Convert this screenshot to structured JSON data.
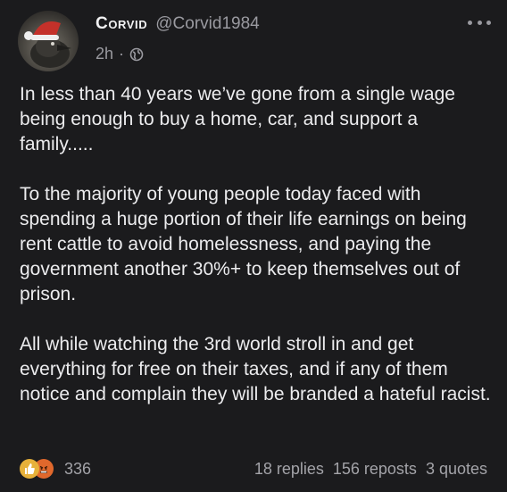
{
  "author": {
    "display_name": "Corvid",
    "handle": "@Corvid1984"
  },
  "meta": {
    "time": "2h",
    "separator": "·",
    "visibility_icon": "globe-icon"
  },
  "more_icon": "more-horizontal-icon",
  "post": {
    "paragraphs": [
      "In less than 40 years we’ve gone from a single wage being enough to buy a home, car, and support a family.....",
      "To the majority of young people today faced with spending a huge portion of their life earnings on being rent cattle to avoid homelessness, and paying the government another 30%+ to keep themselves out of prison.",
      "All while watching the 3rd world stroll in and get everything for free on their taxes, and if any of them notice and complain they will be branded a hateful racist."
    ]
  },
  "footer": {
    "reaction_icons": [
      "thumbs-up-icon",
      "angry-face-icon"
    ],
    "reaction_count": "336",
    "replies": "18 replies",
    "reposts": "156 reposts",
    "quotes": "3 quotes"
  },
  "colors": {
    "background": "#1b1b1d",
    "text": "#ececee",
    "muted": "#9a9aa0",
    "like": "#e7b13a",
    "angry": "#e0682c"
  }
}
